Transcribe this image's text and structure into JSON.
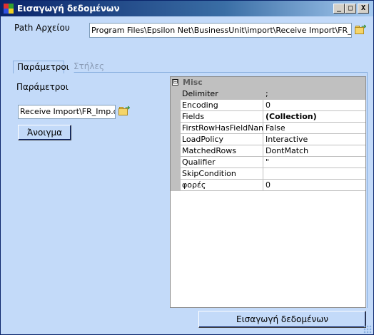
{
  "window": {
    "title": "Εισαγωγή δεδομένων",
    "controls": {
      "minimize": "_",
      "maximize": "□",
      "close": "X"
    }
  },
  "path": {
    "label": "Path Αρχείου",
    "value": "Program Files\\Epsilon Net\\BusinessUnit\\import\\Receive Import\\FR_Imp.csv",
    "browse_icon": "folder-open-icon"
  },
  "tabs": [
    {
      "label": "Παράμετροι",
      "active": true
    },
    {
      "label": "Στήλες",
      "active": false
    }
  ],
  "params": {
    "label": "Παράμετροι",
    "file_value": "Receive Import\\FR_Imp.ctl",
    "browse_icon": "folder-open-icon",
    "open_button": "Άνοιγμα"
  },
  "property_grid": {
    "category": "Misc",
    "collapse_glyph": "⊟",
    "properties": [
      {
        "name": "Delimiter",
        "value": ";",
        "selected": true,
        "bold": false
      },
      {
        "name": "Encoding",
        "value": "0",
        "selected": false,
        "bold": false
      },
      {
        "name": "Fields",
        "value": "(Collection)",
        "selected": false,
        "bold": true
      },
      {
        "name": "FirstRowHasFieldName",
        "value": "False",
        "selected": false,
        "bold": false
      },
      {
        "name": "LoadPolicy",
        "value": "Interactive",
        "selected": false,
        "bold": false
      },
      {
        "name": "MatchedRows",
        "value": "DontMatch",
        "selected": false,
        "bold": false
      },
      {
        "name": "Qualifier",
        "value": "\"",
        "selected": false,
        "bold": false
      },
      {
        "name": "SkipCondition",
        "value": "",
        "selected": false,
        "bold": false
      },
      {
        "name": "φορές",
        "value": "0",
        "selected": false,
        "bold": false
      }
    ]
  },
  "submit_button": "Εισαγωγή δεδομένων",
  "colors": {
    "window_bg": "#c3daf9",
    "titlebar": "#0a246a",
    "grid_line": "#c0c0c0"
  }
}
